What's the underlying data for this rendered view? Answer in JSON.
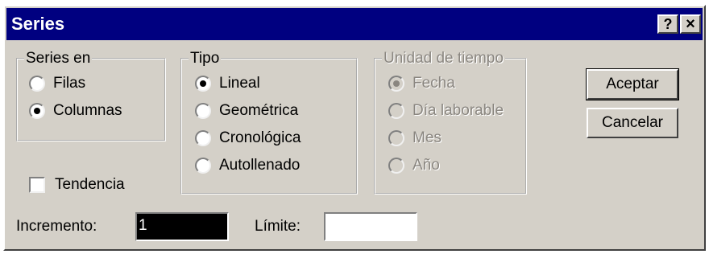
{
  "dialog": {
    "title": "Series",
    "help_label": "?",
    "close_label": "×"
  },
  "series_en": {
    "legend": "Series en",
    "options": [
      {
        "label": "Filas",
        "selected": false
      },
      {
        "label": "Columnas",
        "selected": true
      }
    ]
  },
  "tipo": {
    "legend": "Tipo",
    "options": [
      {
        "label": "Lineal",
        "selected": true
      },
      {
        "label": "Geométrica",
        "selected": false
      },
      {
        "label": "Cronológica",
        "selected": false
      },
      {
        "label": "Autollenado",
        "selected": false
      }
    ]
  },
  "unidad": {
    "legend": "Unidad de tiempo",
    "enabled": false,
    "options": [
      {
        "label": "Fecha",
        "selected": true
      },
      {
        "label": "Día laborable",
        "selected": false
      },
      {
        "label": "Mes",
        "selected": false
      },
      {
        "label": "Año",
        "selected": false
      }
    ]
  },
  "tendencia": {
    "label": "Tendencia",
    "checked": false
  },
  "buttons": {
    "ok": "Aceptar",
    "cancel": "Cancelar"
  },
  "incremento": {
    "label": "Incremento:",
    "value": "1"
  },
  "limite": {
    "label": "Límite:",
    "value": ""
  },
  "colors": {
    "titlebar": "#000080",
    "dialog": "#d4d0c8"
  }
}
